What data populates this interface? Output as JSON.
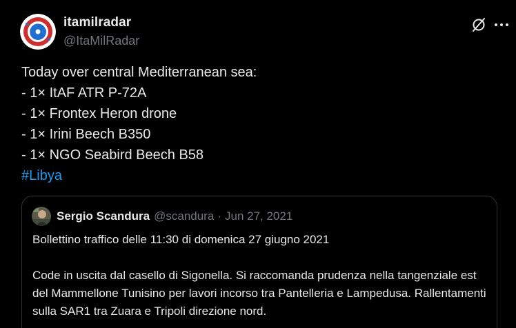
{
  "author": {
    "display_name": "itamilradar",
    "handle": "@ItaMilRadar"
  },
  "tweet": {
    "lines": [
      "Today over central Mediterranean sea:",
      "- 1× ItAF ATR P-72A",
      "- 1× Frontex Heron drone",
      "- 1× Irini Beech B350",
      "- 1× NGO Seabird Beech B58"
    ],
    "hashtag": "#Libya"
  },
  "quote": {
    "display_name": "Sergio Scandura",
    "handle": "@scandura",
    "separator": "·",
    "date": "Jun 27, 2021",
    "paragraph1": "Bollettino traffico delle 11:30 di domenica 27 giugno 2021",
    "paragraph2": "Code in uscita dal casello di Sigonella. Si raccomanda prudenza nella tangenziale est del Mammellone Tunisino per lavori incorso tra Pantelleria e Lampedusa. Rallentamenti sulla SAR1 tra Zuara e Tripoli direzione nord."
  },
  "icons": {
    "grok": "grok-icon",
    "more": "more-icon"
  },
  "colors": {
    "background": "#000000",
    "text": "#e7e9ea",
    "secondary": "#71767b",
    "link": "#1d9bf0",
    "border": "#2f3336"
  }
}
